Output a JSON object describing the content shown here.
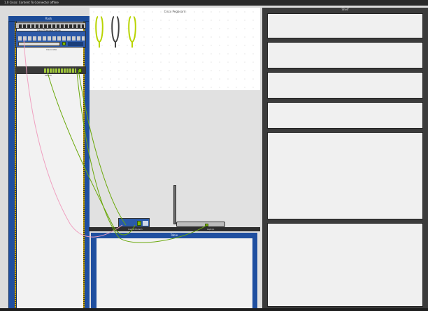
{
  "window": {
    "title": "1.0 Cisco: Content To Connector offline"
  },
  "rack": {
    "label": "Rack"
  },
  "workspace": {
    "label": "Cisco Pegboard"
  },
  "table": {
    "label": "Table"
  },
  "right_panel": {
    "label": "Shelf"
  },
  "devices": {
    "firewall_label": "Cisco ASA",
    "router_label": "Cisco Firepower Series",
    "switch_label": "Switch",
    "modem_label": "Cable Modem",
    "laptop_label": "Laptop"
  },
  "colors": {
    "rack_blue": "#1f4fa0",
    "cable_green": "#6aa80a",
    "cable_pink": "#f0a0c0",
    "cable_gray": "#444444"
  }
}
